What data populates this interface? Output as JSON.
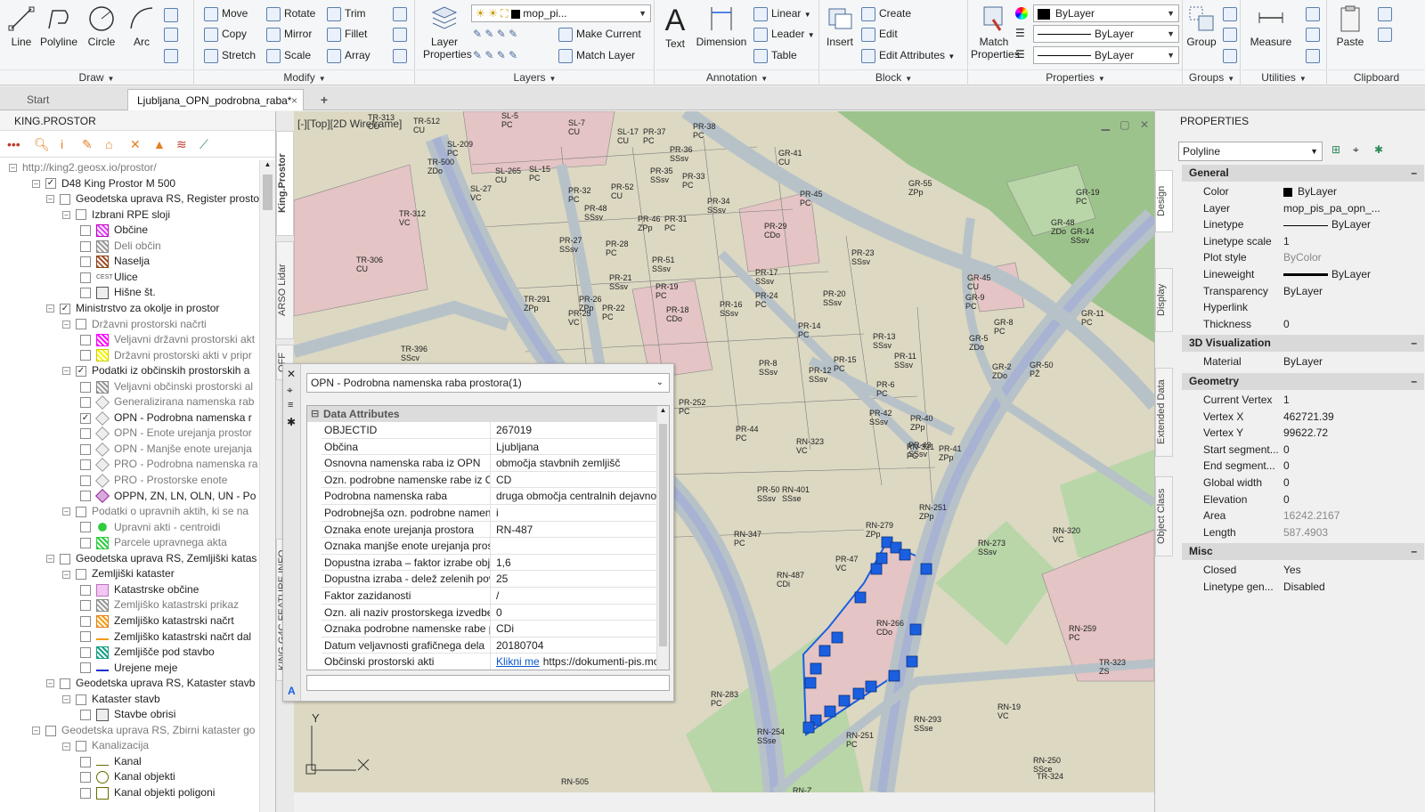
{
  "ribbon": {
    "draw": {
      "title": "Draw",
      "line": "Line",
      "polyline": "Polyline",
      "circle": "Circle",
      "arc": "Arc"
    },
    "modify": {
      "title": "Modify",
      "move": "Move",
      "rotate": "Rotate",
      "trim": "Trim",
      "copy": "Copy",
      "mirror": "Mirror",
      "fillet": "Fillet",
      "stretch": "Stretch",
      "scale": "Scale",
      "array": "Array"
    },
    "layers": {
      "title": "Layers",
      "layer_properties": "Layer Properties",
      "current_layer": "mop_pi...",
      "make_current": "Make Current",
      "match_layer": "Match Layer"
    },
    "annotation": {
      "title": "Annotation",
      "text": "Text",
      "dimension": "Dimension",
      "linear": "Linear",
      "leader": "Leader",
      "table": "Table"
    },
    "block": {
      "title": "Block",
      "insert": "Insert",
      "create": "Create",
      "edit": "Edit",
      "edit_attributes": "Edit Attributes"
    },
    "properties": {
      "title": "Properties",
      "match_properties": "Match Properties",
      "color": "ByLayer",
      "linetype": "ByLayer",
      "lineweight": "ByLayer"
    },
    "groups": {
      "title": "Groups",
      "group": "Group"
    },
    "utilities": {
      "title": "Utilities",
      "measure": "Measure"
    },
    "clipboard": {
      "title": "Clipboard",
      "paste": "Paste"
    }
  },
  "tabs": [
    {
      "label": "Start"
    },
    {
      "label": "Ljubljana_OPN_podrobna_raba*"
    }
  ],
  "left_panel": {
    "title": "KING.PROSTOR",
    "url": "http://king2.geosx.io/prostor/",
    "tree": [
      {
        "label": "D48 King Prostor M 500"
      },
      {
        "label": "Geodetska uprava RS, Register prosto"
      },
      {
        "label": "Izbrani RPE sloji"
      },
      {
        "label": "Občine"
      },
      {
        "label": "Deli občin"
      },
      {
        "label": "Naselja"
      },
      {
        "label": "Ulice"
      },
      {
        "label": "Hišne št."
      },
      {
        "label": "Ministrstvo za okolje in prostor"
      },
      {
        "label": "Državni prostorski načrti"
      },
      {
        "label": "Veljavni državni prostorski akt"
      },
      {
        "label": "Državni prostorski akti v pripr"
      },
      {
        "label": "Podatki iz občinskih prostorskih a"
      },
      {
        "label": "Veljavni občinski prostorski al"
      },
      {
        "label": "Generalizirana namenska rab"
      },
      {
        "label": "OPN - Podrobna namenska r"
      },
      {
        "label": "OPN - Enote urejanja prostor"
      },
      {
        "label": "OPN - Manjše enote urejanja"
      },
      {
        "label": "PRO - Podrobna namenska ra"
      },
      {
        "label": "PRO - Prostorske enote"
      },
      {
        "label": "OPPN, ZN, LN, OLN, UN - Po"
      },
      {
        "label": "Podatki o upravnih aktih, ki se na"
      },
      {
        "label": "Upravni akti - centroidi"
      },
      {
        "label": "Parcele upravnega akta"
      },
      {
        "label": "Geodetska uprava RS, Zemljiški katas"
      },
      {
        "label": "Zemljiški kataster"
      },
      {
        "label": "Katastrske občine"
      },
      {
        "label": "Zemljiško katastrski prikaz"
      },
      {
        "label": "Zemljiško katastrski načrt"
      },
      {
        "label": "Zemljiško katastrski načrt dal"
      },
      {
        "label": "Zemljišče pod stavbo"
      },
      {
        "label": "Urejene meje"
      },
      {
        "label": "Geodetska uprava RS, Kataster stavb"
      },
      {
        "label": "Kataster stavb"
      },
      {
        "label": "Stavbe obrisi"
      },
      {
        "label": "Geodetska uprava RS, Zbirni kataster go"
      },
      {
        "label": "Kanalizacija"
      },
      {
        "label": "Kanal"
      },
      {
        "label": "Kanal objekti"
      },
      {
        "label": "Kanal objekti poligoni"
      }
    ],
    "street_abbr": "CEST"
  },
  "side_tabs": {
    "king_prostor": "King.Prostor",
    "arso_lidar": "ARSO Lidar",
    "third": "OFF",
    "feature_info": "KING.G4C FEATURE INFO"
  },
  "viewport": {
    "label": "[-][Top][2D Wireframe]",
    "axis_y": "Y",
    "axis_x": "X"
  },
  "map_labels": [
    {
      "t": "TR-313\nCU"
    },
    {
      "t": "TR-512\nCU"
    },
    {
      "t": "SL-5\nPC"
    },
    {
      "t": "SL-7\nCU"
    },
    {
      "t": "SL-17\nCU"
    },
    {
      "t": "PR-37\nPC"
    },
    {
      "t": "PR-38\nPC"
    },
    {
      "t": "SL-209\nPC"
    },
    {
      "t": "TR-500\nZDo"
    },
    {
      "t": "SL-265\nCU"
    },
    {
      "t": "SL-15\nPC"
    },
    {
      "t": "SL-27\nVC"
    },
    {
      "t": "PR-36\nSSsv"
    },
    {
      "t": "PR-35\nSSsv"
    },
    {
      "t": "PR-33\nPC"
    },
    {
      "t": "PR-32\nPC"
    },
    {
      "t": "PR-52\nCU"
    },
    {
      "t": "PR-34\nSSsv"
    },
    {
      "t": "PR-48\nSSsv"
    },
    {
      "t": "PR-31\nPC"
    },
    {
      "t": "PR-46\nZPp"
    },
    {
      "t": "PR-29\nCDo"
    },
    {
      "t": "GR-41\nCU"
    },
    {
      "t": "GR-55\nZPp"
    },
    {
      "t": "PR-45\nPC"
    },
    {
      "t": "GR-19\nPC"
    },
    {
      "t": "TR-312\nVC"
    },
    {
      "t": "TR-306\nCU"
    },
    {
      "t": "PR-27\nSSsv"
    },
    {
      "t": "PR-28\nPC"
    },
    {
      "t": "PR-51\nSSsv"
    },
    {
      "t": "PR-23\nSSsv"
    },
    {
      "t": "GR-48\nZDo"
    },
    {
      "t": "GR-14\nSSsv"
    },
    {
      "t": "PR-21\nSSsv"
    },
    {
      "t": "PR-17\nSSsv"
    },
    {
      "t": "TR-291\nZPp"
    },
    {
      "t": "PR-26\nZPp"
    },
    {
      "t": "PR-19\nPC"
    },
    {
      "t": "PR-25\nVC"
    },
    {
      "t": "PR-22\nPC"
    },
    {
      "t": "PR-18\nCDo"
    },
    {
      "t": "PR-16\nSSsv"
    },
    {
      "t": "PR-24\nPC"
    },
    {
      "t": "PR-20\nSSsv"
    },
    {
      "t": "GR-45\nCU"
    },
    {
      "t": "GR-9\nPC"
    },
    {
      "t": "GR-11\nPC"
    },
    {
      "t": "PR-14\nPC"
    },
    {
      "t": "TR-396\nSScv"
    },
    {
      "t": "PR-8\nSSsv"
    },
    {
      "t": "PR-12\nSSsv"
    },
    {
      "t": "PR-15\nPC"
    },
    {
      "t": "PR-13\nSSsv"
    },
    {
      "t": "PR-11\nSSsv"
    },
    {
      "t": "GR-8\nPC"
    },
    {
      "t": "GR-5\nZDo"
    },
    {
      "t": "GR-2\nZDo"
    },
    {
      "t": "GR-50\nPŽ"
    },
    {
      "t": "PR-6\nPC"
    },
    {
      "t": "PR-252\nPC"
    },
    {
      "t": "PR-44\nPC"
    },
    {
      "t": "PR-42\nSSsv"
    },
    {
      "t": "PR-40\nZPp"
    },
    {
      "t": "PR-43\nSSsv"
    },
    {
      "t": "RN-323\nVC"
    },
    {
      "t": "RN-321\nPC"
    },
    {
      "t": "PR-41\nZPp"
    },
    {
      "t": "PR-50\nSSsv"
    },
    {
      "t": "RN-401\nSSse"
    },
    {
      "t": "RN-251\nZPp"
    },
    {
      "t": "RN-347\nPC"
    },
    {
      "t": "RN-279\nZPp"
    },
    {
      "t": "RN-273\nSSsv"
    },
    {
      "t": "RN-320\nVC"
    },
    {
      "t": "PR-47\nVC"
    },
    {
      "t": "RN-487\nCDi"
    },
    {
      "t": "RN-266\nCDo"
    },
    {
      "t": "RN-259\nPC"
    },
    {
      "t": "TR-323\nZS"
    },
    {
      "t": "RN-283\nPC"
    },
    {
      "t": "RN-293\nSSse"
    },
    {
      "t": "RN-19\nVC"
    },
    {
      "t": "RN-254\nSSse"
    },
    {
      "t": "RN-251\nPC"
    },
    {
      "t": "RN-250\nSSce"
    },
    {
      "t": "TR-324"
    },
    {
      "t": "RN-505"
    },
    {
      "t": "RN-Z\nZD"
    }
  ],
  "feature_info": {
    "layer": "OPN - Podrobna namenska raba prostora(1)",
    "section": "Data Attributes",
    "rows": [
      {
        "k": "OBJECTID",
        "v": "267019"
      },
      {
        "k": "Občina",
        "v": "Ljubljana"
      },
      {
        "k": "Osnovna namenska raba iz OPN",
        "v": "območja stavbnih zemljišč"
      },
      {
        "k": "Ozn. podrobne namenske rabe iz OPN",
        "v": "CD"
      },
      {
        "k": "Podrobna namenska raba",
        "v": "druga območja centralnih dejavnosti"
      },
      {
        "k": "Podrobnejša ozn. podrobne namenske rabe",
        "v": "i"
      },
      {
        "k": "Oznaka enote urejanja prostora",
        "v": "RN-487"
      },
      {
        "k": "Oznaka manjše enote urejanja prostora",
        "v": ""
      },
      {
        "k": "Dopustna izraba – faktor izrabe objektov",
        "v": "1,6"
      },
      {
        "k": "Dopustna izraba - delež zelenih površin",
        "v": "25"
      },
      {
        "k": "Faktor zazidanosti",
        "v": "/"
      },
      {
        "k": "Ozn. ali naziv prostorskega izvedbenega akta",
        "v": "0"
      },
      {
        "k": "Oznaka podrobne namenske rabe prostora",
        "v": "CDi"
      },
      {
        "k": "Datum veljavnosti grafičnega dela",
        "v": "20180704"
      },
      {
        "k": "Občinski prostorski akti",
        "v": "https://dokumenti-pis.mop.gov.si",
        "link": "Klikni me"
      }
    ]
  },
  "properties": {
    "title": "PROPERTIES",
    "object_type": "Polyline",
    "side_tabs": [
      "Design",
      "Display",
      "Extended Data",
      "Object Class"
    ],
    "sections": [
      {
        "name": "General",
        "rows": [
          {
            "k": "Color",
            "v": "ByLayer"
          },
          {
            "k": "Layer",
            "v": "mop_pis_pa_opn_..."
          },
          {
            "k": "Linetype",
            "v": "ByLayer"
          },
          {
            "k": "Linetype scale",
            "v": "1"
          },
          {
            "k": "Plot style",
            "v": "ByColor"
          },
          {
            "k": "Lineweight",
            "v": "ByLayer"
          },
          {
            "k": "Transparency",
            "v": "ByLayer"
          },
          {
            "k": "Hyperlink",
            "v": ""
          },
          {
            "k": "Thickness",
            "v": "0"
          }
        ]
      },
      {
        "name": "3D Visualization",
        "rows": [
          {
            "k": "Material",
            "v": "ByLayer"
          }
        ]
      },
      {
        "name": "Geometry",
        "rows": [
          {
            "k": "Current Vertex",
            "v": "1"
          },
          {
            "k": "Vertex X",
            "v": "462721.39"
          },
          {
            "k": "Vertex Y",
            "v": "99622.72"
          },
          {
            "k": "Start segment...",
            "v": "0"
          },
          {
            "k": "End segment...",
            "v": "0"
          },
          {
            "k": "Global width",
            "v": "0"
          },
          {
            "k": "Elevation",
            "v": "0"
          },
          {
            "k": "Area",
            "v": "16242.2167"
          },
          {
            "k": "Length",
            "v": "587.4903"
          }
        ]
      },
      {
        "name": "Misc",
        "rows": [
          {
            "k": "Closed",
            "v": "Yes"
          },
          {
            "k": "Linetype gen...",
            "v": "Disabled"
          }
        ]
      }
    ]
  },
  "colors": {
    "selection": "#1a5fe0",
    "zone_pink": "#e5c6c6",
    "zone_green": "#b7d4a6",
    "road": "#b6c3c9",
    "rail": "#aab4d6"
  }
}
